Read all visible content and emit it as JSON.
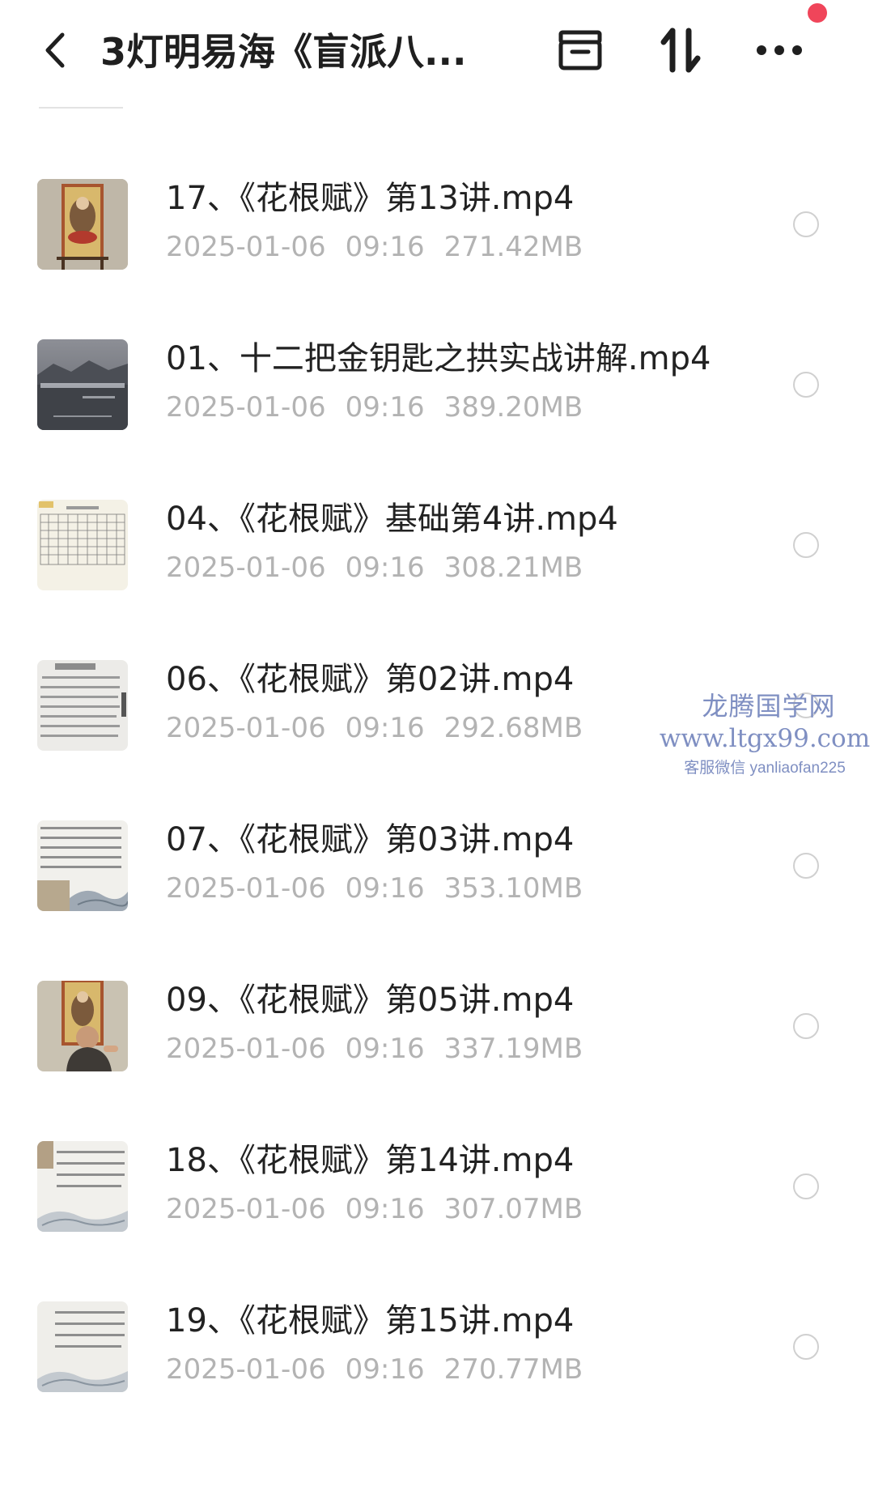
{
  "header": {
    "title": "3灯明易海《盲派八...",
    "icons": [
      "back-chevron-icon",
      "archive-box-icon",
      "sort-arrows-icon",
      "more-dots-icon"
    ],
    "notification_color": "#f0455a"
  },
  "files": [
    {
      "name": "17、《花根赋》第13讲.mp4",
      "date": "2025-01-06",
      "time": "09:16",
      "size": "271.42MB",
      "thumb": "thangka"
    },
    {
      "name": "01、十二把金钥匙之拱实战讲解.mp4",
      "date": "2025-01-06",
      "time": "09:16",
      "size": "389.20MB",
      "thumb": "landscape"
    },
    {
      "name": "04、《花根赋》基础第4讲.mp4",
      "date": "2025-01-06",
      "time": "09:16",
      "size": "308.21MB",
      "thumb": "table"
    },
    {
      "name": "06、《花根赋》第02讲.mp4",
      "date": "2025-01-06",
      "time": "09:16",
      "size": "292.68MB",
      "thumb": "text"
    },
    {
      "name": "07、《花根赋》第03讲.mp4",
      "date": "2025-01-06",
      "time": "09:16",
      "size": "353.10MB",
      "thumb": "text-waves"
    },
    {
      "name": "09、《花根赋》第05讲.mp4",
      "date": "2025-01-06",
      "time": "09:16",
      "size": "337.19MB",
      "thumb": "thangka-person"
    },
    {
      "name": "18、《花根赋》第14讲.mp4",
      "date": "2025-01-06",
      "time": "09:16",
      "size": "307.07MB",
      "thumb": "text-waves"
    },
    {
      "name": "19、《花根赋》第15讲.mp4",
      "date": "2025-01-06",
      "time": "09:16",
      "size": "270.77MB",
      "thumb": "text-waves"
    }
  ],
  "watermark": {
    "line1": "龙腾国学网",
    "line2": "www.ltgx99.com",
    "line3": "客服微信 yanliaofan225"
  }
}
